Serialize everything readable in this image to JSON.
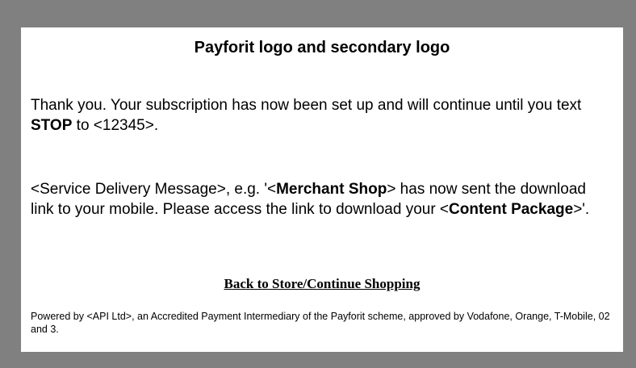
{
  "header": {
    "title": "Payforit logo and secondary logo"
  },
  "confirmation": {
    "line_start": "Thank you.  Your subscription has now been set up and will continue until you text ",
    "stop_keyword": "STOP",
    "line_mid": " to ",
    "shortcode": "<12345>",
    "line_end": "."
  },
  "delivery": {
    "text_start": "<Service Delivery Message>, e.g. '<",
    "merchant": "Merchant Shop",
    "text_mid": "> has now sent the download link to your mobile.  Please access the link to download your <",
    "content_package": "Content Package",
    "text_end": ">'."
  },
  "nav": {
    "back_link_label": "Back to Store/Continue Shopping"
  },
  "footer": {
    "powered_by": "Powered by <API Ltd>, an Accredited Payment Intermediary of the Payforit scheme, approved by Vodafone, Orange, T-Mobile, 02 and 3."
  },
  "colors": {
    "frame_background": "#808080",
    "panel_background": "#ffffff",
    "text": "#000000"
  }
}
